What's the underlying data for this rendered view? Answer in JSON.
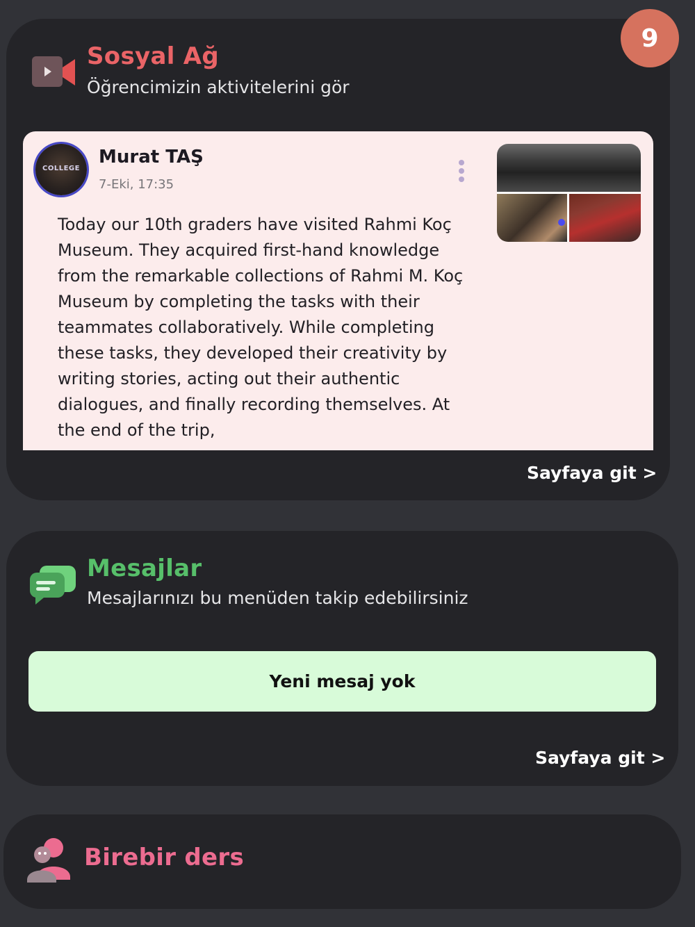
{
  "social": {
    "title": "Sosyal Ağ",
    "subtitle": "Öğrencimizin aktivitelerini gör",
    "badge_count": "9",
    "icon": "video-camera-icon",
    "post": {
      "author": "Murat TAŞ",
      "date": "7-Eki, 17:35",
      "avatar_text": "COLLEGE",
      "text": "Today our 10th graders have visited Rahmi Koç Museum. They acquired first-hand knowledge from the remarkable collections of Rahmi M. Koç Museum by completing the tasks with their teammates collaboratively. While completing these tasks, they developed their creativity by writing stories, acting out their authentic dialogues, and finally recording themselves. At the end of the trip,"
    },
    "goto_label": "Sayfaya git >"
  },
  "messages": {
    "title": "Mesajlar",
    "subtitle": "Mesajlarınızı bu menüden takip edebilirsiniz",
    "icon": "chat-bubbles-icon",
    "status": "Yeni mesaj yok",
    "goto_label": "Sayfaya git >"
  },
  "lesson": {
    "title": "Birebir ders",
    "icon": "person-icon"
  },
  "colors": {
    "social_title": "#ea6467",
    "messages_title": "#57bf6a",
    "lesson_title": "#ec6c90",
    "badge": "#d6725e",
    "message_banner": "#d8fbd9"
  }
}
